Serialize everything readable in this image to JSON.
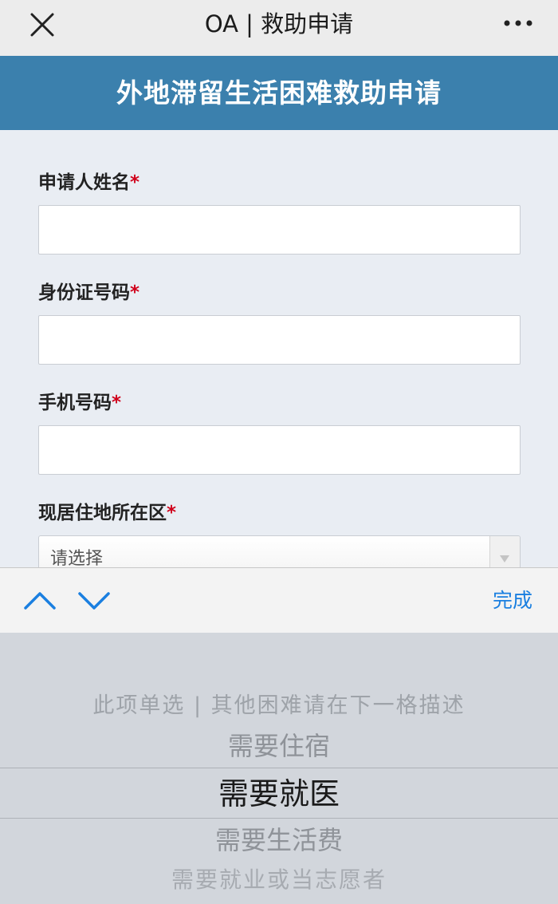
{
  "nav": {
    "title": "OA | 救助申请",
    "close_icon": "close-icon",
    "more_icon": "more-icon"
  },
  "banner": {
    "title": "外地滞留生活困难救助申请"
  },
  "form": {
    "name_label": "申请人姓名",
    "id_label": "身份证号码",
    "phone_label": "手机号码",
    "district_label": "现居住地所在区",
    "required_mark": "*",
    "district_placeholder": "请选择"
  },
  "toolbar": {
    "prev_icon": "chevron-up-icon",
    "next_icon": "chevron-down-icon",
    "done_label": "完成",
    "accent": "#1a7fe0"
  },
  "picker": {
    "options": [
      "此项单选 | 其他困难请在下一格描述",
      "需要住宿",
      "需要就医",
      "需要生活费",
      "需要就业或当志愿者"
    ],
    "selected": "需要就医"
  },
  "colors": {
    "banner": "#3b80ad",
    "required": "#d0021b",
    "background": "#e9edf3"
  }
}
